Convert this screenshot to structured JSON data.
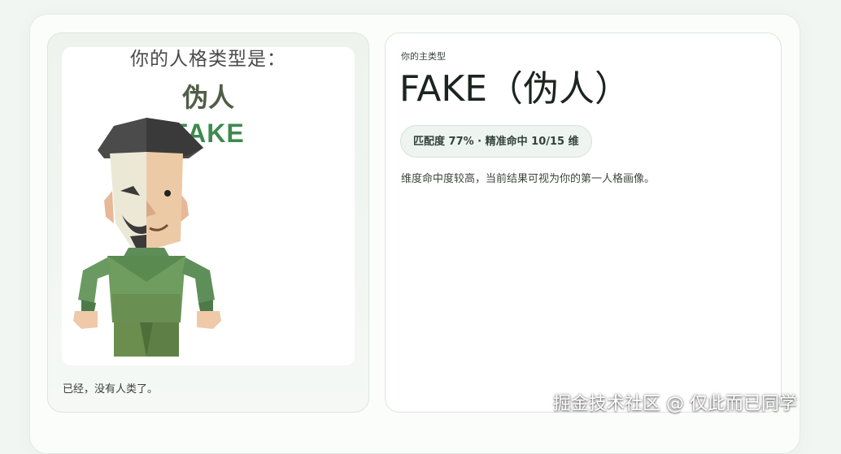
{
  "poster": {
    "heading": "你的人格类型是：",
    "type_cn": "伪人",
    "type_en": "FAKE"
  },
  "caption": "已经，没有人类了。",
  "result": {
    "eyebrow": "你的主类型",
    "title": "FAKE（伪人）",
    "pill": "匹配度 77% · 精准命中 10/15 维",
    "match_percent": 77,
    "hits": 10,
    "dimensions": 15,
    "description": "维度命中度较高，当前结果可视为你的第一人格画像。"
  },
  "watermark": "掘金技术社区 @ 仅此而已同学",
  "colors": {
    "accent_green": "#3f8a4f",
    "body_green": "#6b9a5a",
    "mask": "#ece8d6"
  },
  "icons": [
    "fake-character-illustration"
  ]
}
